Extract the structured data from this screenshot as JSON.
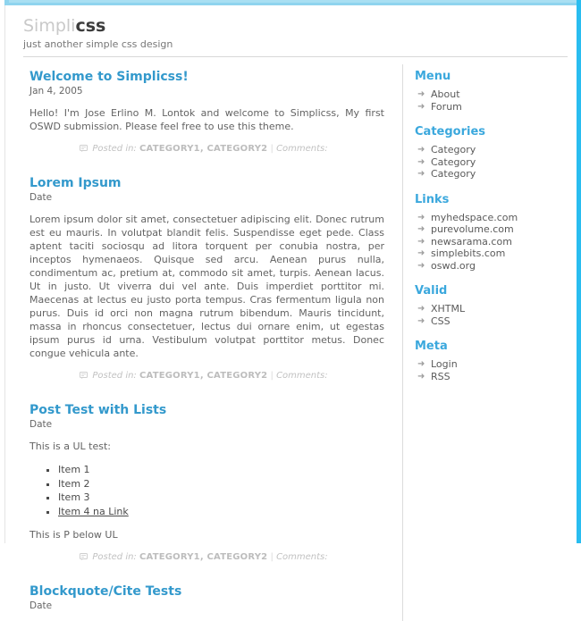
{
  "theme": {
    "accent_top": "#8fd4ee",
    "accent_right": "#29bdf0",
    "heading_blue": "#3399cc",
    "sidebar_blue": "#3ba8dd",
    "body_text": "#636363",
    "meta_gray": "#c2c2c2"
  },
  "header": {
    "logo_light": "Simpli",
    "logo_dark": "css",
    "tagline": "just another simple css design"
  },
  "posts": [
    {
      "title": "Welcome to Simplicss!",
      "date": "Jan 4, 2005",
      "paragraphs": [
        "Hello! I'm Jose Erlino M. Lontok and welcome to Simplicss, My first OSWD submission. Please feel free to use this theme."
      ],
      "meta": {
        "icon": "comment-bubble-icon",
        "posted_in_label": "Posted in:",
        "categories": "CATEGORY1, CATEGORY2",
        "separator": "|",
        "comments_label": "Comments:"
      }
    },
    {
      "title": "Lorem Ipsum",
      "date": "Date",
      "paragraphs": [
        "Lorem ipsum dolor sit amet, consectetuer adipiscing elit. Donec rutrum est eu mauris. In volutpat blandit felis. Suspendisse eget pede. Class aptent taciti sociosqu ad litora torquent per conubia nostra, per inceptos hymenaeos. Quisque sed arcu. Aenean purus nulla, condimentum ac, pretium at, commodo sit amet, turpis. Aenean lacus. Ut in justo. Ut viverra dui vel ante. Duis imperdiet porttitor mi. Maecenas at lectus eu justo porta tempus. Cras fermentum ligula non purus. Duis id orci non magna rutrum bibendum. Mauris tincidunt, massa in rhoncus consectetuer, lectus dui ornare enim, ut egestas ipsum purus id urna. Vestibulum volutpat porttitor metus. Donec congue vehicula ante."
      ],
      "meta": {
        "icon": "comment-bubble-icon",
        "posted_in_label": "Posted in:",
        "categories": "CATEGORY1, CATEGORY2",
        "separator": "|",
        "comments_label": "Comments:"
      }
    },
    {
      "title": "Post Test with Lists",
      "date": "Date",
      "intro": "This is a UL test:",
      "list_items": [
        "Item 1",
        "Item 2",
        "Item 3",
        "Item 4 na Link"
      ],
      "outro": "This is P below UL",
      "meta": {
        "icon": "comment-bubble-icon",
        "posted_in_label": "Posted in:",
        "categories": "CATEGORY1, CATEGORY2",
        "separator": "|",
        "comments_label": "Comments:"
      }
    },
    {
      "title": "Blockquote/Cite Tests",
      "date": "Date"
    }
  ],
  "sidebar": {
    "blocks": [
      {
        "title": "Menu",
        "items": [
          "About",
          "Forum"
        ]
      },
      {
        "title": "Categories",
        "items": [
          "Category",
          "Category",
          "Category"
        ]
      },
      {
        "title": "Links",
        "items": [
          "myhedspace.com",
          "purevolume.com",
          "newsarama.com",
          "simplebits.com",
          "oswd.org"
        ]
      },
      {
        "title": "Valid",
        "items": [
          "XHTML",
          "CSS"
        ]
      },
      {
        "title": "Meta",
        "items": [
          "Login",
          "RSS"
        ]
      }
    ],
    "bullet_glyph": "➜"
  }
}
